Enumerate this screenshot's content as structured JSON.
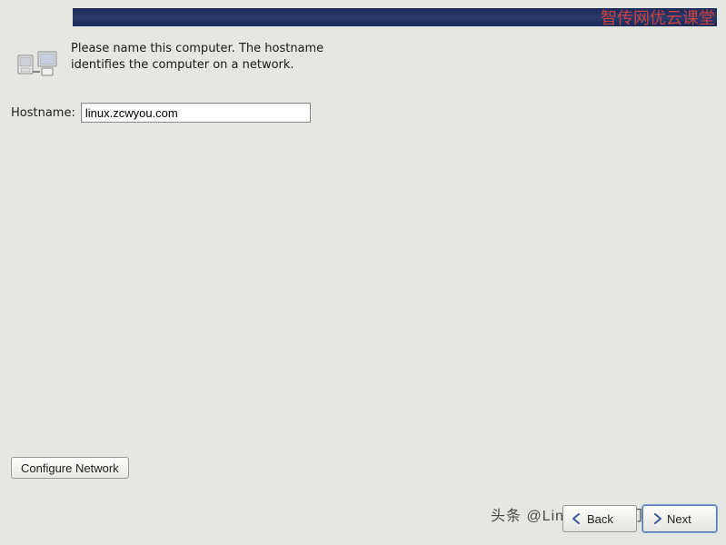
{
  "watermark_top": "智传网优云课堂",
  "description": "Please name this computer.  The hostname identifies the computer on a network.",
  "hostname": {
    "label": "Hostname:",
    "value": "linux.zcwyou.com"
  },
  "configure_network_label": "Configure Network",
  "nav": {
    "back_label": "Back",
    "next_label": "Next"
  },
  "watermark_bottom": "头条 @Linux基础入门教程"
}
